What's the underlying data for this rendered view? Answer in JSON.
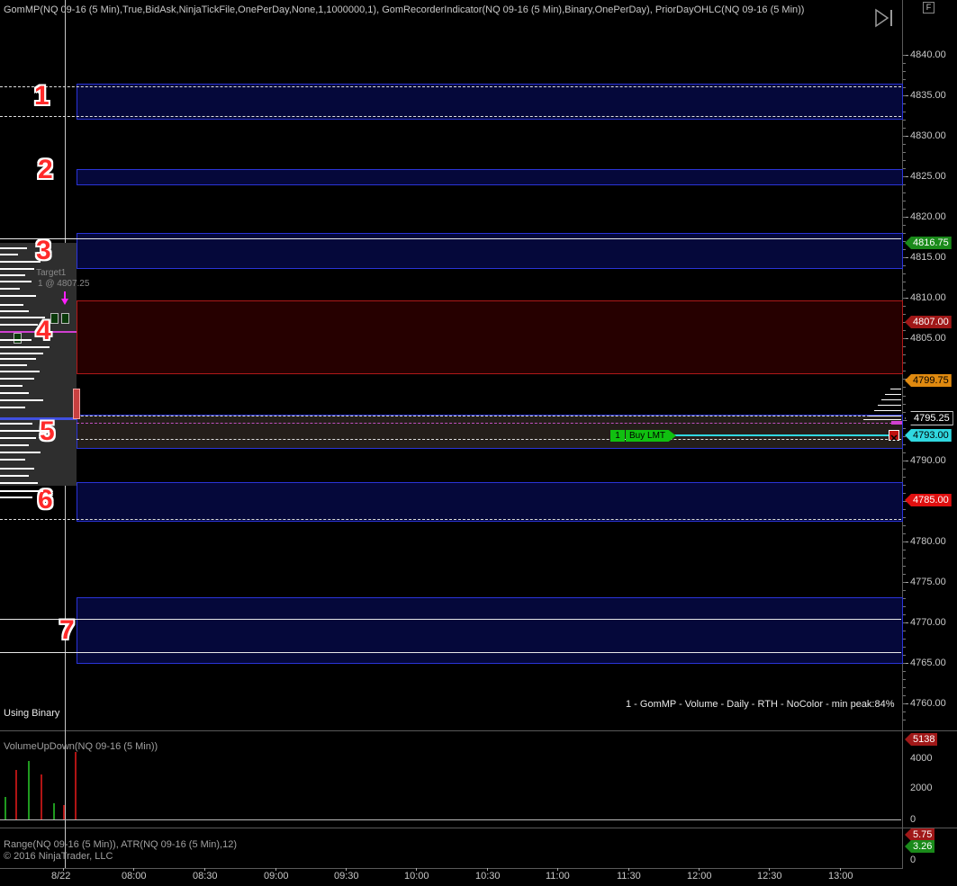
{
  "header": {
    "indicators": "GomMP(NQ 09-16 (5 Min),True,BidAsk,NinjaTickFile,OnePerDay,None,1,1000000,1), GomRecorderIndicator(NQ 09-16 (5 Min),Binary,OnePerDay), PriorDayOHLC(NQ 09-16 (5 Min))",
    "f_button": "F"
  },
  "price_axis": {
    "ticks": [
      "4840.00",
      "4835.00",
      "4830.00",
      "4825.00",
      "4820.00",
      "4815.00",
      "4810.00",
      "4805.00",
      "4800.00",
      "4795.00",
      "4790.00",
      "4785.00",
      "4780.00",
      "4775.00",
      "4770.00",
      "4765.00",
      "4760.00"
    ]
  },
  "price_tags": [
    {
      "label": "4816.75",
      "bg": "#1a8a1a",
      "fg": "#ffffff"
    },
    {
      "label": "4807.00",
      "bg": "#a01818",
      "fg": "#ffffff"
    },
    {
      "label": "4799.75",
      "bg": "#e08a10",
      "fg": "#000000"
    },
    {
      "label": "4795.25",
      "bg": "#000000",
      "fg": "#ffffff"
    },
    {
      "label": "4793.00",
      "bg": "#30d8e0",
      "fg": "#000000"
    },
    {
      "label": "4785.00",
      "bg": "#e01010",
      "fg": "#ffffff"
    }
  ],
  "zone_numbers": [
    "1",
    "2",
    "3",
    "4",
    "5",
    "6",
    "7"
  ],
  "target_label": "Target1",
  "target_qty": "1 @ 4807.25",
  "order": {
    "qty": "1",
    "label": "Buy LMT"
  },
  "info_text": "1 - GomMP  - Volume - Daily - RTH - NoColor - min peak:84%",
  "status_text": "Using Binary",
  "volume_panel": {
    "title": "VolumeUpDown(NQ 09-16 (5 Min))",
    "ticks": [
      "4000",
      "2000",
      "0"
    ],
    "last_value": "5138",
    "bars_direction": [
      "up",
      "down",
      "up",
      "down",
      "up",
      "down",
      "down"
    ]
  },
  "range_panel": {
    "title": "Range(NQ 09-16 (5 Min)), ATR(NQ 09-16 (5 Min),12)",
    "ticks": [
      "0"
    ],
    "range_value": "5.75",
    "atr_value": "3.26"
  },
  "copyright": "© 2016 NinjaTrader, LLC",
  "time_axis": [
    "8/22",
    "08:00",
    "08:30",
    "09:00",
    "09:30",
    "10:00",
    "10:30",
    "11:00",
    "11:30",
    "12:00",
    "12:30",
    "13:00"
  ],
  "colors": {
    "zone_border": "#2a34d8",
    "zone_fill": "#05083a",
    "red_zone": "#b01818",
    "up_bar": "#1f9a1f",
    "down_bar": "#b01414"
  }
}
